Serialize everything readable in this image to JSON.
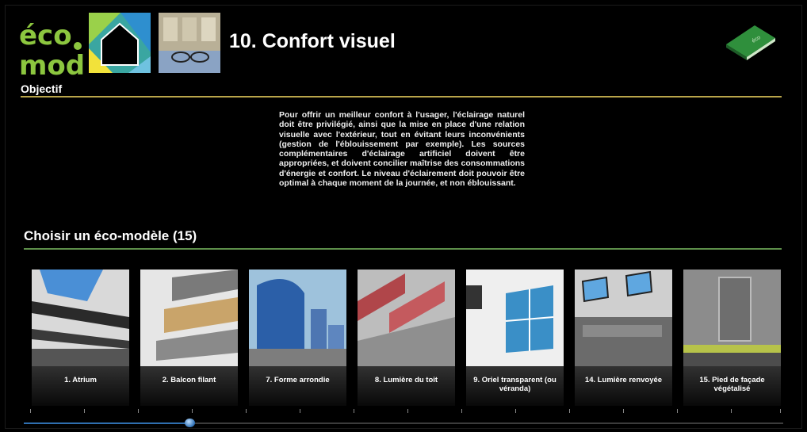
{
  "logo": {
    "text": "éco mod"
  },
  "header": {
    "title": "10. Confort visuel"
  },
  "objectif": {
    "label": "Objectif",
    "text": "Pour offrir un meilleur confort à l'usager, l'éclairage naturel doit être privilégié, ainsi que la mise en place d'une relation visuelle avec l'extérieur, tout en évitant leurs inconvénients (gestion de l'éblouissement par exemple). Les sources complémentaires d'éclairage artificiel doivent être appropriées, et doivent concilier maîtrise des consommations d'énergie et confort. Le niveau d'éclairement doit pouvoir être optimal à chaque moment de la journée, et non éblouissant."
  },
  "section": {
    "title": "Choisir un éco-modèle (15)"
  },
  "cards": [
    {
      "label": "1. Atrium"
    },
    {
      "label": "2. Balcon filant"
    },
    {
      "label": "7. Forme arrondie"
    },
    {
      "label": "8. Lumière du toit"
    },
    {
      "label": "9. Oriel transparent (ou véranda)"
    },
    {
      "label": "14. Lumière renvoyée"
    },
    {
      "label": "15. Pied de façade végétalisé"
    }
  ],
  "colors": {
    "gold_rule": "#b9a54a",
    "green_rule": "#5d8f4a",
    "slider_accent": "#2f6fb0"
  },
  "slider": {
    "position_fraction": 0.22
  }
}
